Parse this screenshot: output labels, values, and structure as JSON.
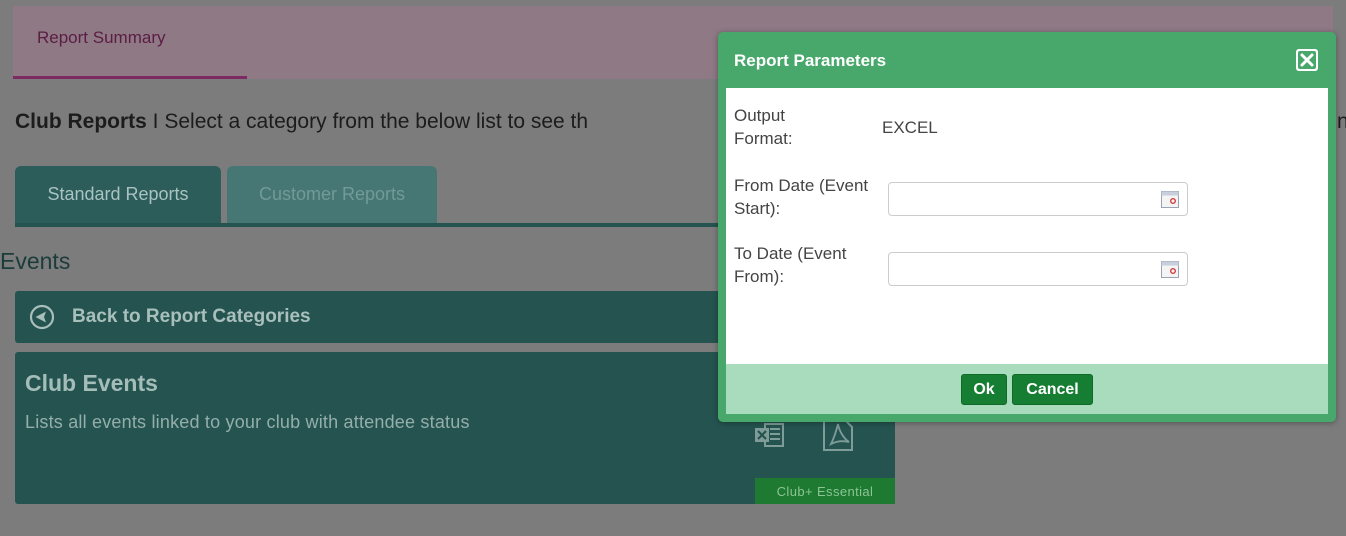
{
  "top_nav": {
    "active_tab": "Report Summary"
  },
  "header": {
    "title_bold": "Club Reports",
    "title_rest": " I Select a category from the below list to see th",
    "clipped_right": "n"
  },
  "tabs": [
    {
      "label": "Standard Reports",
      "active": true
    },
    {
      "label": "Customer Reports",
      "active": false
    }
  ],
  "section": {
    "title": "Events",
    "back_label": "Back to Report Categories"
  },
  "card": {
    "title": "Club Events",
    "description": "Lists all events linked to your club with attendee status",
    "badge": "Club+ Essential",
    "icons": [
      "excel-icon",
      "pdf-icon"
    ]
  },
  "modal": {
    "title": "Report Parameters",
    "fields": [
      {
        "label": "Output Format:",
        "value": "EXCEL"
      },
      {
        "label": "From Date (Event Start):",
        "value": ""
      },
      {
        "label": "To Date (Event From):",
        "value": ""
      }
    ],
    "ok_label": "Ok",
    "cancel_label": "Cancel"
  },
  "colors": {
    "modal_header": "#48a86b",
    "button": "#157e32",
    "card_bg": "#255450",
    "badge": "#1d7a30"
  }
}
